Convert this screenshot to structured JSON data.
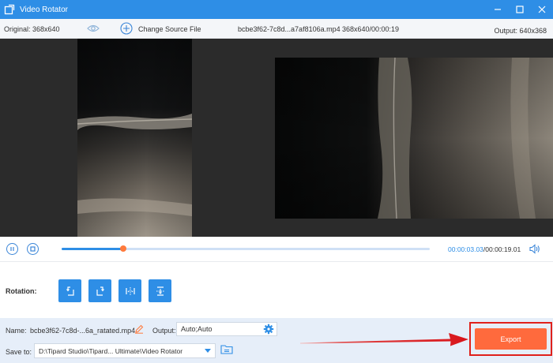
{
  "window": {
    "title": "Video Rotator"
  },
  "info_bar": {
    "original": "Original: 368x640",
    "change_source": "Change Source File",
    "file_name": "bcbe3f62-7c8d...a7af8106a.mp4",
    "resolution_duration": "368x640/00:00:19",
    "output": "Output: 640x368"
  },
  "playback": {
    "current_time": "00:00:03.03",
    "total_time": "/00:00:19.01",
    "progress": 0.167
  },
  "rotation": {
    "label": "Rotation:",
    "buttons": [
      "rotate-left",
      "rotate-right",
      "flip-horizontal",
      "flip-vertical"
    ]
  },
  "output_settings": {
    "name_label": "Name:",
    "name_value": "bcbe3f62-7c8d-...6a_ratated.mp4",
    "output_label": "Output:",
    "output_value": "Auto;Auto",
    "save_label": "Save to:",
    "save_path": "D:\\Tipard Studio\\Tipard... Ultimate\\Video Rotator"
  },
  "export": {
    "label": "Export"
  },
  "colors": {
    "accent": "#2e8ee6",
    "export": "#ff6a3d",
    "highlight": "#e0201b",
    "progress_thumb": "#ff7a3c"
  }
}
